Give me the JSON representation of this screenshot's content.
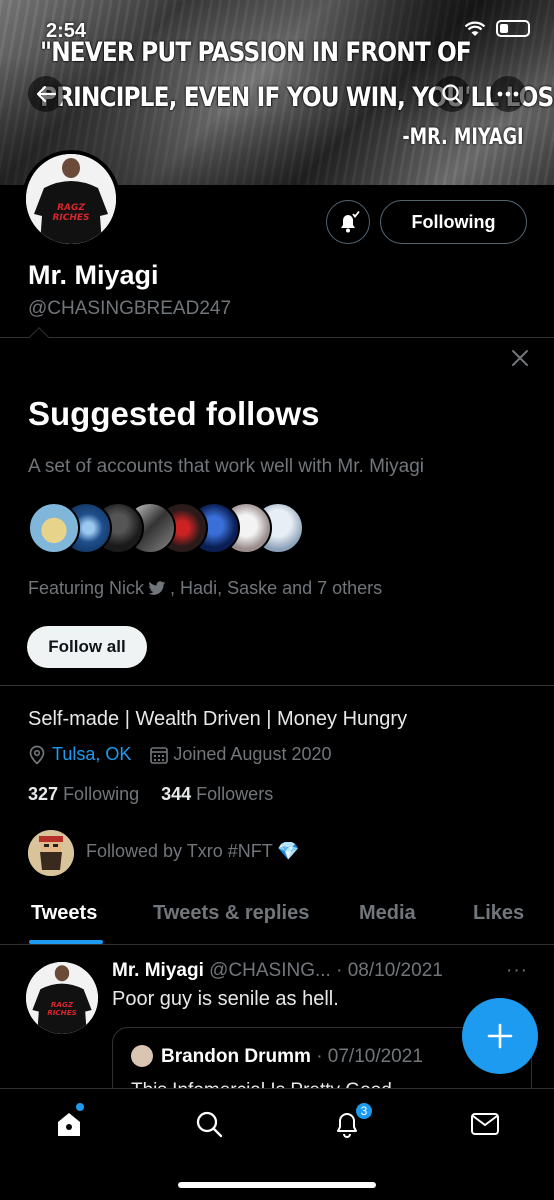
{
  "status_bar": {
    "time": "2:54"
  },
  "banner": {
    "quote_line1": "\"NEVER PUT PASSION IN FRONT OF",
    "quote_line2": "PRINCIPLE, EVEN IF YOU WIN, YOU'LL LOSE.\"",
    "author": "-MR. MIYAGI"
  },
  "profile": {
    "name": "Mr. Miyagi",
    "handle": "@CHASINGBREAD247",
    "following_button": "Following",
    "bio": "Self-made | Wealth Driven | Money Hungry",
    "location": "Tulsa, OK",
    "joined": "Joined August 2020",
    "following_count": "327",
    "following_label": "Following",
    "followers_count": "344",
    "followers_label": "Followers",
    "followed_by": "Followed by Txro #NFT 💎"
  },
  "suggested": {
    "title": "Suggested follows",
    "subtitle": "A set of accounts that work well with Mr. Miyagi",
    "featuring_prefix": "Featuring Nick",
    "featuring_suffix": ", Hadi, Saske and 7 others",
    "follow_all": "Follow all"
  },
  "tabs": [
    {
      "label": "Tweets"
    },
    {
      "label": "Tweets & replies"
    },
    {
      "label": "Media"
    },
    {
      "label": "Likes"
    }
  ],
  "tweet": {
    "name": "Mr. Miyagi",
    "handle": "@CHASING...",
    "date": "· 08/10/2021",
    "more": "···",
    "text": "Poor guy is senile as hell.",
    "quote": {
      "name": "Brandon Drumm",
      "date": "· 07/10/2021",
      "text": "This Infomercial Is Pretty Good..."
    }
  },
  "bottom_nav": {
    "notifications_badge": "3"
  },
  "colors": {
    "accent": "#1d9bf0",
    "muted": "#71767b",
    "background": "#000000"
  }
}
